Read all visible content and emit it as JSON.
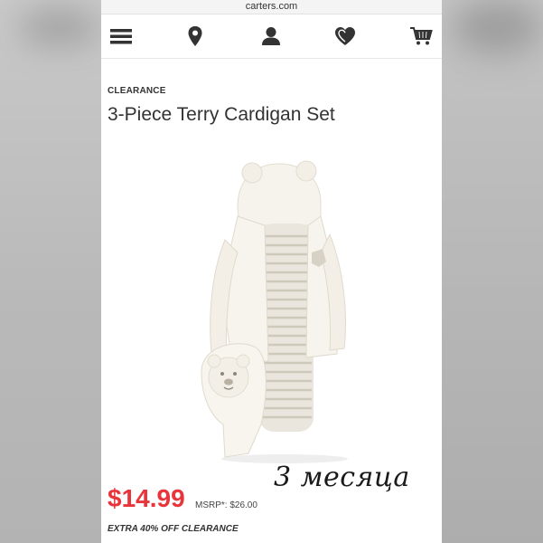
{
  "browser": {
    "url": "carters.com"
  },
  "nav": {
    "icons": [
      "menu-icon",
      "location-icon",
      "account-icon",
      "heart-icon",
      "cart-icon"
    ]
  },
  "product": {
    "badge": "CLEARANCE",
    "title": "3-Piece Terry Cardigan Set",
    "price": "$14.99",
    "msrp": "MSRP*: $26.00",
    "promo": "EXTRA 40% OFF CLEARANCE"
  },
  "overlay": {
    "handwritten_note": "3 месяца"
  },
  "colors": {
    "price": "#e8343a",
    "text": "#333333",
    "page_background": "#ffffff",
    "outer_background": "#bdbdbd"
  }
}
